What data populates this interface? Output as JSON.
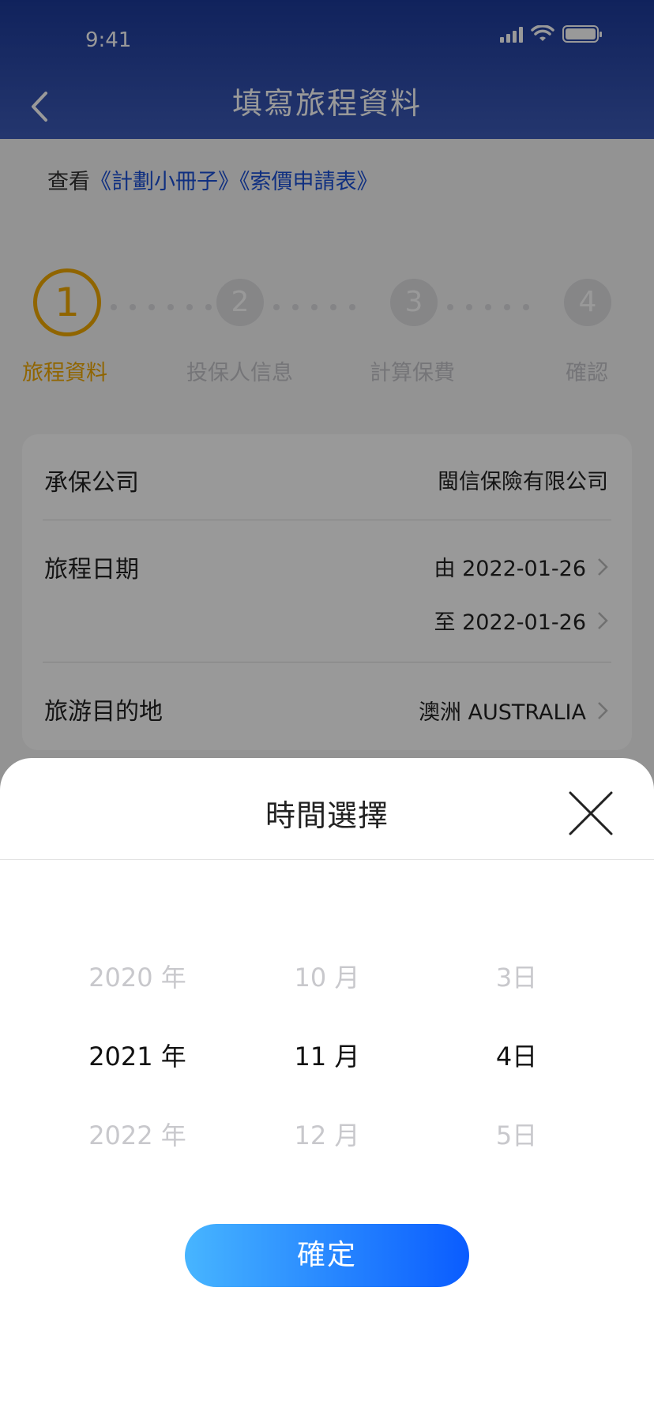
{
  "status_bar": {
    "time": "9:41"
  },
  "header": {
    "title": "填寫旅程資料"
  },
  "links": {
    "prefix": "查看",
    "brochure": "《計劃小冊子》",
    "quote_form": "《索價申請表》"
  },
  "stepper": {
    "steps": [
      {
        "number": "1",
        "label": "旅程資料"
      },
      {
        "number": "2",
        "label": "投保人信息"
      },
      {
        "number": "3",
        "label": "計算保費"
      },
      {
        "number": "4",
        "label": "確認"
      }
    ],
    "active_step": 1
  },
  "form": {
    "insurer": {
      "label": "承保公司",
      "value": "閩信保險有限公司"
    },
    "trip_dates": {
      "label": "旅程日期",
      "from": "由 2022-01-26",
      "to": "至 2022-01-26"
    },
    "destination": {
      "label": "旅游目的地",
      "value": "澳洲 AUSTRALIA"
    }
  },
  "date_picker": {
    "title": "時間選擇",
    "years": [
      "2020 年",
      "2021 年",
      "2022 年"
    ],
    "months": [
      "10 月",
      "11 月",
      "12 月"
    ],
    "days": [
      "3日",
      "4日",
      "5日"
    ],
    "confirm_label": "確定"
  },
  "colors": {
    "header": "#1c3a9a",
    "accent": "#f1a800",
    "link": "#1a4fd6",
    "button_start": "#47b5ff",
    "button_end": "#0a5cff"
  }
}
